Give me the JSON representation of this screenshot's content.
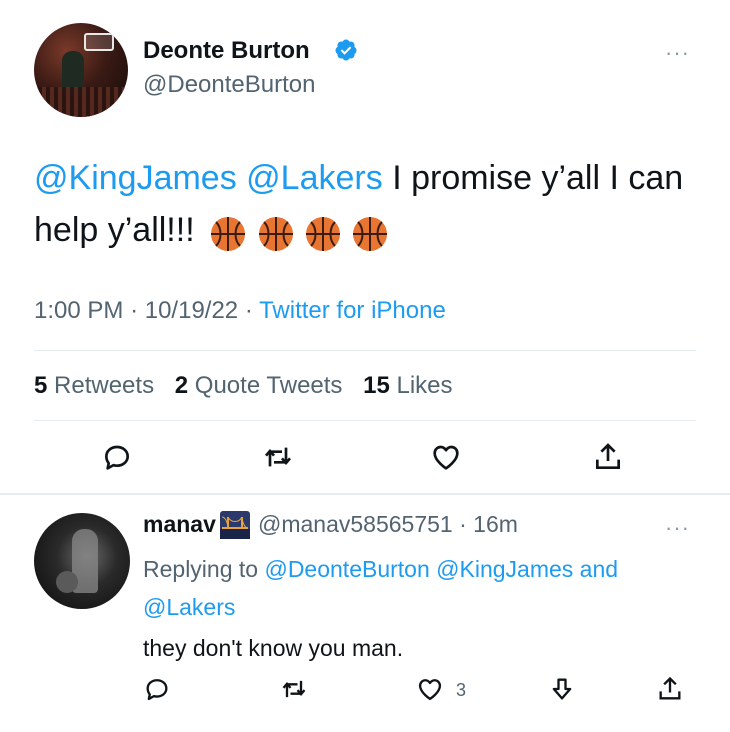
{
  "tweet": {
    "author_name": "Deonte Burton",
    "author_handle": "@DeonteBurton",
    "mention_1": "@KingJames",
    "mention_2": "@Lakers",
    "text_part_1": " I promise y’all I can help y’all!!!",
    "emoji": "🏀🏀🏀🏀",
    "time": "1:00 PM",
    "date": "10/19/22",
    "source": "Twitter for iPhone",
    "retweets_count": "5",
    "retweets_label": "Retweets",
    "quotes_count": "2",
    "quotes_label": "Quote Tweets",
    "likes_count": "15",
    "likes_label": "Likes",
    "more": "···"
  },
  "reply": {
    "author_name": "manav",
    "flag_icon": "bridge-at-night-emoji",
    "author_handle": "@manav58565751",
    "time": "16m",
    "replying_prefix": "Replying to",
    "replying_1": "@DeonteBurton",
    "replying_2": "@KingJames",
    "replying_and": "and",
    "replying_3": "@Lakers",
    "text": "they don't know you man.",
    "likes_count": "3",
    "more": "···"
  },
  "colors": {
    "accent": "#1d9bf0",
    "secondary_text": "#536471",
    "primary_text": "#0f1419",
    "divider": "#e6ecf0"
  }
}
